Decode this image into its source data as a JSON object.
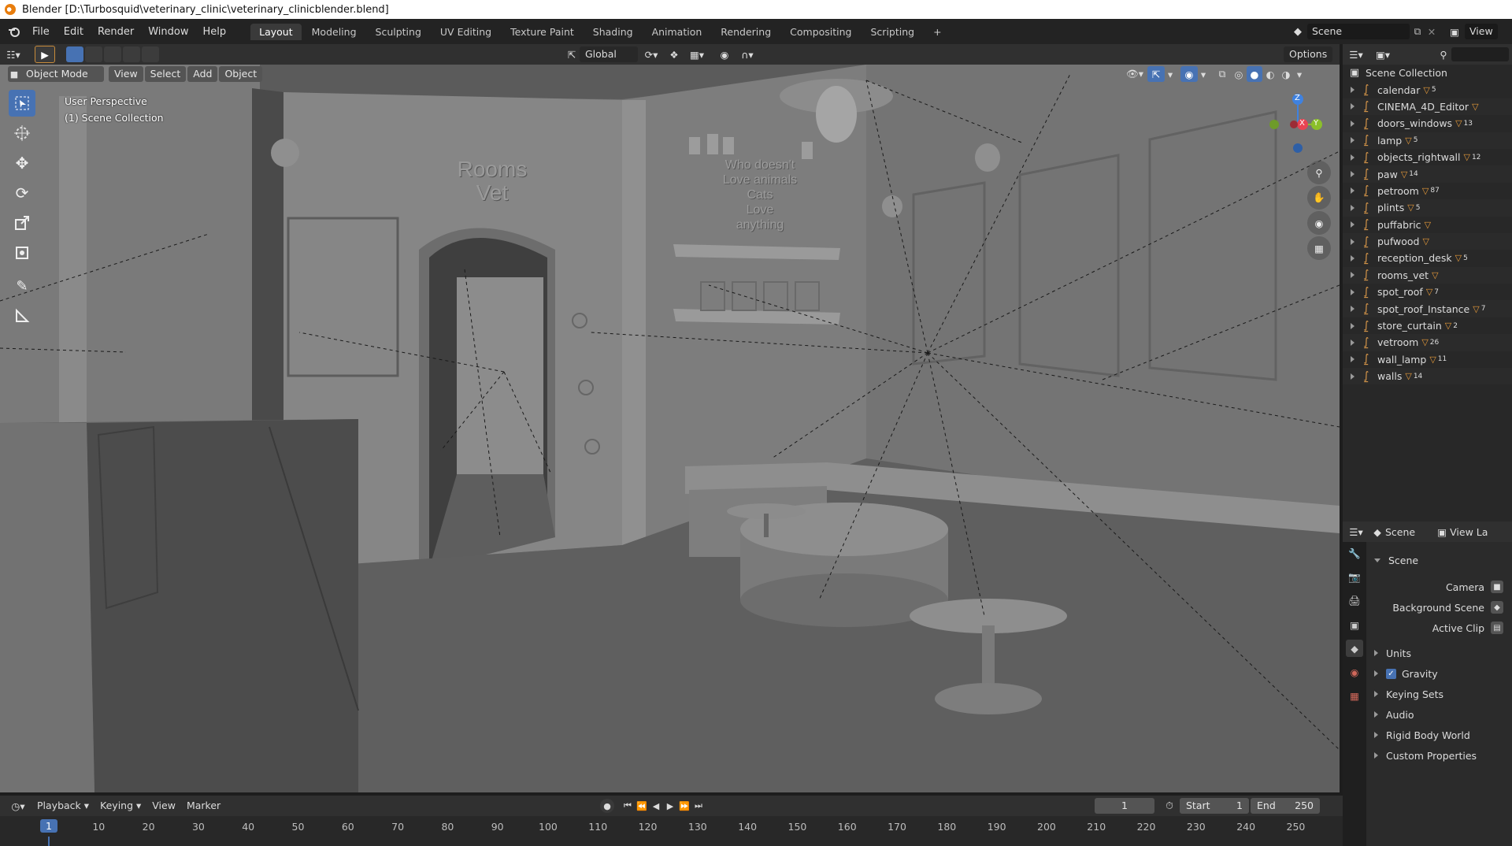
{
  "window": {
    "title": "Blender [D:\\Turbosquid\\veterinary_clinic\\veterinary_clinicblender.blend]"
  },
  "menubar": {
    "menus": [
      "File",
      "Edit",
      "Render",
      "Window",
      "Help"
    ],
    "workspaces": [
      "Layout",
      "Modeling",
      "Sculpting",
      "UV Editing",
      "Texture Paint",
      "Shading",
      "Animation",
      "Rendering",
      "Compositing",
      "Scripting"
    ],
    "active_workspace": "Layout",
    "add_workspace": "+",
    "scene_name": "Scene",
    "view_layer": "View"
  },
  "viewport_header": {
    "transform_orientation": "Global",
    "options": "Options",
    "mode": "Object Mode",
    "menus": [
      "View",
      "Select",
      "Add",
      "Object"
    ]
  },
  "viewport": {
    "perspective_label": "User Perspective",
    "collection_label": "(1) Scene Collection",
    "wall_text_1": "Rooms",
    "wall_text_2": "Vet",
    "slogan": [
      "Who doesn't",
      "Love animals",
      "Cats",
      "Love",
      "anything"
    ],
    "gizmo_axes": {
      "x": "X",
      "y": "Y",
      "z": "Z"
    },
    "colors": {
      "x": "#e84453",
      "y": "#8bbf2a",
      "z": "#3f82e0"
    }
  },
  "outliner": {
    "root": "Scene Collection",
    "items": [
      {
        "name": "calendar",
        "badge": "5"
      },
      {
        "name": "CINEMA_4D_Editor",
        "badge": ""
      },
      {
        "name": "doors_windows",
        "badge": "13"
      },
      {
        "name": "lamp",
        "badge": "5"
      },
      {
        "name": "objects_rightwall",
        "badge": "12"
      },
      {
        "name": "paw",
        "badge": "14"
      },
      {
        "name": "petroom",
        "badge": "87"
      },
      {
        "name": "plints",
        "badge": "5"
      },
      {
        "name": "puffabric",
        "badge": ""
      },
      {
        "name": "pufwood",
        "badge": ""
      },
      {
        "name": "reception_desk",
        "badge": "5"
      },
      {
        "name": "rooms_vet",
        "badge": ""
      },
      {
        "name": "spot_roof",
        "badge": "7"
      },
      {
        "name": "spot_roof_Instance",
        "badge": "7"
      },
      {
        "name": "store_curtain",
        "badge": "2"
      },
      {
        "name": "vetroom",
        "badge": "26"
      },
      {
        "name": "wall_lamp",
        "badge": "11"
      },
      {
        "name": "walls",
        "badge": "14"
      }
    ]
  },
  "properties": {
    "header_scene": "Scene",
    "header_view_layer": "View La",
    "section": "Scene",
    "fields": [
      {
        "label": "Camera"
      },
      {
        "label": "Background Scene"
      },
      {
        "label": "Active Clip"
      }
    ],
    "panels": [
      "Units",
      "Gravity",
      "Keying Sets",
      "Audio",
      "Rigid Body World",
      "Custom Properties"
    ],
    "gravity_checked": true
  },
  "timeline": {
    "menus": [
      "Playback",
      "Keying",
      "View",
      "Marker"
    ],
    "current_frame": "1",
    "start_label": "Start",
    "start_value": "1",
    "end_label": "End",
    "end_value": "250",
    "ruler": [
      "1",
      "10",
      "20",
      "30",
      "40",
      "50",
      "60",
      "70",
      "80",
      "90",
      "100",
      "110",
      "120",
      "130",
      "140",
      "150",
      "160",
      "170",
      "180",
      "190",
      "200",
      "210",
      "220",
      "230",
      "240",
      "250"
    ]
  },
  "theme": {
    "accent": "#4772b3",
    "brand": "#e87d0d"
  }
}
